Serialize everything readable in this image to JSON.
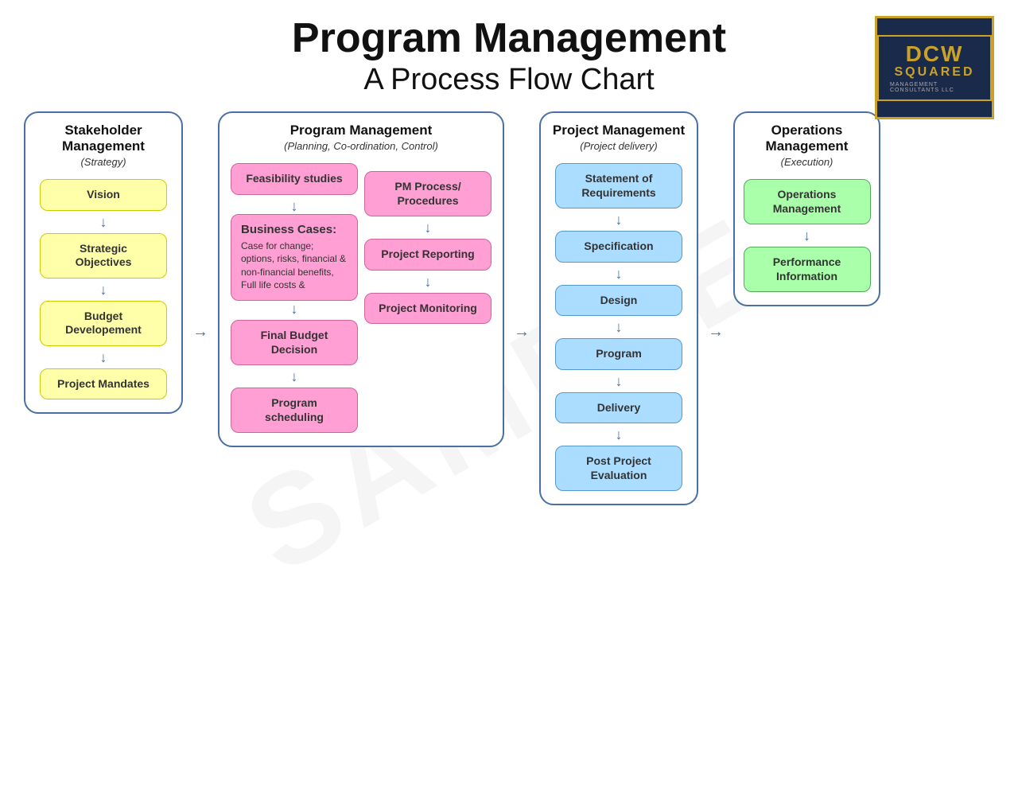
{
  "page": {
    "title": "Program Management",
    "subtitle": "A Process Flow Chart",
    "watermark": "SAMPLE"
  },
  "logo": {
    "line1": "DCW",
    "line2": "SQUARED",
    "line3": "MANAGEMENT CONSULTANTS LLC"
  },
  "columns": {
    "stakeholder": {
      "title": "Stakeholder Management",
      "subtitle": "(Strategy)",
      "nodes": [
        {
          "label": "Vision",
          "color": "yellow"
        },
        {
          "label": "Strategic Objectives",
          "color": "yellow"
        },
        {
          "label": "Budget Developement",
          "color": "yellow"
        },
        {
          "label": "Project Mandates",
          "color": "yellow"
        }
      ]
    },
    "program": {
      "title": "Program Management",
      "subtitle": "(Planning, Co-ordination, Control)",
      "left_nodes": [
        {
          "label": "Feasibility studies",
          "color": "pink"
        },
        {
          "label": "Business Cases:",
          "subtext": "Case for change; options, risks, financial & non-financial benefits, Full life costs &",
          "color": "pink-large"
        },
        {
          "label": "Final Budget Decision",
          "color": "pink"
        },
        {
          "label": "Program scheduling",
          "color": "pink"
        }
      ],
      "right_nodes": [
        {
          "label": "PM Process/ Procedures",
          "color": "pink"
        },
        {
          "label": "Project Reporting",
          "color": "pink"
        },
        {
          "label": "Project Monitoring",
          "color": "pink"
        }
      ]
    },
    "project": {
      "title": "Project Management",
      "subtitle": "(Project delivery)",
      "nodes": [
        {
          "label": "Statement of Requirements",
          "color": "blue"
        },
        {
          "label": "Specification",
          "color": "blue"
        },
        {
          "label": "Design",
          "color": "blue"
        },
        {
          "label": "Program",
          "color": "blue"
        },
        {
          "label": "Delivery",
          "color": "blue"
        },
        {
          "label": "Post Project Evaluation",
          "color": "blue"
        }
      ]
    },
    "operations": {
      "title": "Operations Management",
      "subtitle": "(Execution)",
      "nodes": [
        {
          "label": "Operations Management",
          "color": "green"
        },
        {
          "label": "Performance Information",
          "color": "green"
        }
      ]
    }
  },
  "arrows": {
    "down": "↓",
    "right": "→"
  }
}
